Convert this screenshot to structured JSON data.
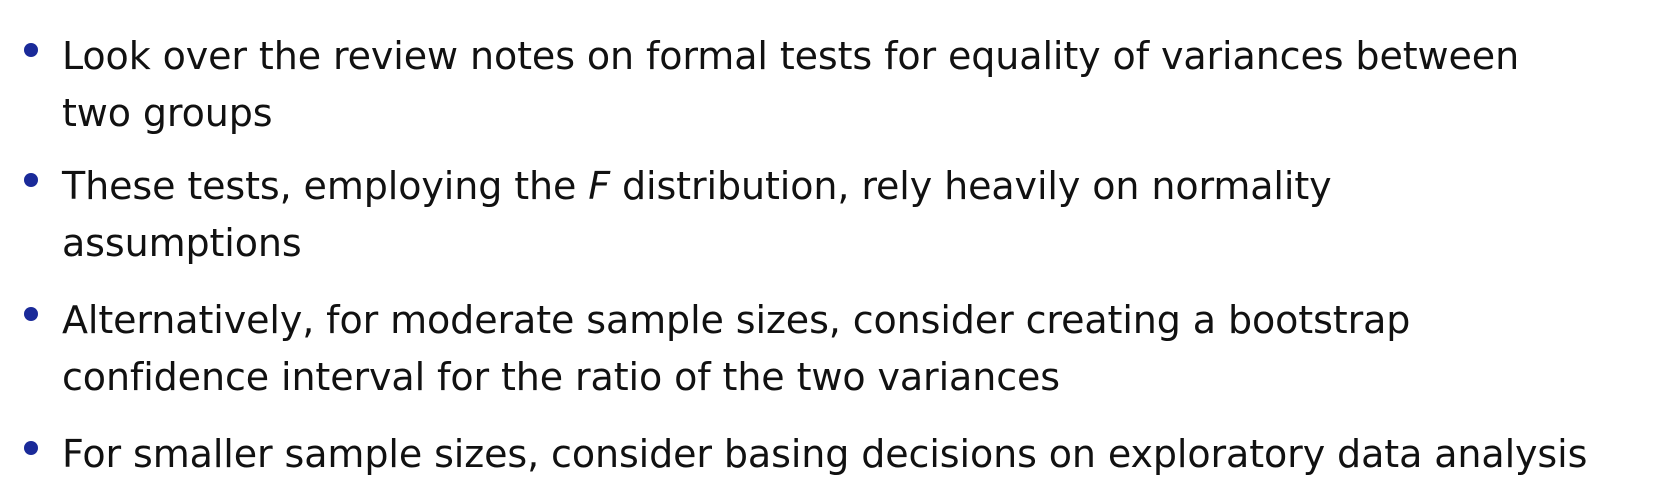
{
  "slide": {
    "bullets": [
      {
        "line1": "Look over the review notes on formal tests for equality of variances between",
        "line2": "two groups"
      },
      {
        "line1_before": "These tests, employing the ",
        "line1_var": "F",
        "line1_after": " distribution, rely heavily on normality",
        "line2": "assumptions"
      },
      {
        "line1": "Alternatively, for moderate sample sizes, consider creating a bootstrap",
        "line2": "confidence interval for the ratio of the two variances"
      },
      {
        "line1": "For smaller sample sizes, consider basing decisions on exploratory data analysis"
      }
    ],
    "colors": {
      "bullet": "#1a2a99",
      "text": "#111111",
      "background": "#ffffff"
    }
  }
}
